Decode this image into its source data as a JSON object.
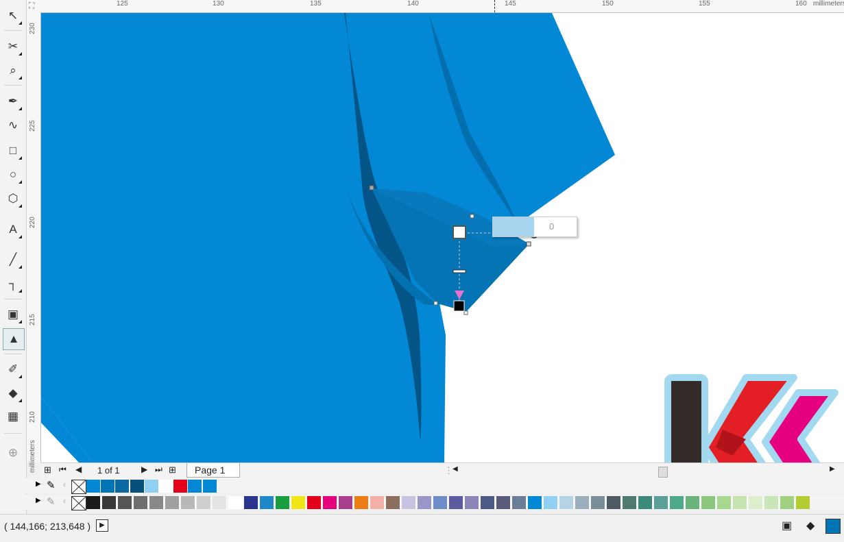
{
  "ruler": {
    "unit_label": "millimeters",
    "h_ticks": [
      "125",
      "130",
      "135",
      "140",
      "145",
      "150",
      "155",
      "160"
    ],
    "v_ticks": [
      "230",
      "225",
      "220",
      "215",
      "210"
    ]
  },
  "toolbox": {
    "tools": [
      {
        "name": "shape-tool-icon",
        "glyph": "↖"
      },
      {
        "name": "crop-tool-icon",
        "glyph": "✂"
      },
      {
        "name": "zoom-tool-icon",
        "glyph": "⌕"
      },
      {
        "name": "pen-tool-icon",
        "glyph": "✒"
      },
      {
        "name": "artistic-media-icon",
        "glyph": "∿"
      },
      {
        "name": "rectangle-tool-icon",
        "glyph": "□"
      },
      {
        "name": "ellipse-tool-icon",
        "glyph": "○"
      },
      {
        "name": "polygon-tool-icon",
        "glyph": "⬡"
      },
      {
        "name": "text-tool-icon",
        "glyph": "A"
      },
      {
        "name": "dimension-tool-icon",
        "glyph": "╱"
      },
      {
        "name": "connector-tool-icon",
        "glyph": "┐"
      },
      {
        "name": "drop-shadow-tool-icon",
        "glyph": "▣"
      },
      {
        "name": "interactive-fill-icon",
        "glyph": "▲"
      },
      {
        "name": "eyedropper-tool-icon",
        "glyph": "✐"
      },
      {
        "name": "smart-fill-icon",
        "glyph": "◆"
      },
      {
        "name": "mesh-fill-icon",
        "glyph": "▦"
      },
      {
        "name": "add-tool-icon",
        "glyph": "⊕"
      }
    ]
  },
  "transparency_tip": {
    "value": "0"
  },
  "pagebar": {
    "page_counter": "1 of 1",
    "tab_label": "Page 1"
  },
  "document_palette": [
    "#0288d4",
    "#0174b5",
    "#0a6aa1",
    "#06507c",
    "#8fd0f3",
    "#ffffff",
    "#e2001a",
    "#0288d4",
    "#0288d4"
  ],
  "default_palette": [
    "#1a1a1a",
    "#3a3a3a",
    "#555555",
    "#6e6e6e",
    "#888888",
    "#a0a0a0",
    "#b8b8b8",
    "#cfcfcf",
    "#e4e4e4",
    "#ffffff",
    "#2a3590",
    "#1e88c8",
    "#1a9d40",
    "#f0e616",
    "#e2001a",
    "#e5007d",
    "#a73f8c",
    "#ef7d16",
    "#f2b0a8",
    "#8c6e5e",
    "#c8c4e0",
    "#9a96c8",
    "#6e8cc8",
    "#5c5aa0",
    "#8c86b8",
    "#4c5a86",
    "#5a5a7a",
    "#6a7e96",
    "#0288d4",
    "#8fd0f3",
    "#b4d4e4",
    "#9aaebc",
    "#7a8e9a",
    "#4e5a62",
    "#4e7a70",
    "#3c8a7a",
    "#5aa096",
    "#4ea88a",
    "#6ab47c",
    "#8cc87c",
    "#a8d890",
    "#c6e4b0",
    "#dceecc",
    "#c8e6b8",
    "#a0d080",
    "#b4cc30"
  ],
  "status": {
    "coords": "( 144,166; 213,648 )"
  },
  "colors": {
    "object_blue": "#0288d4",
    "dark_blue": "#04507e",
    "logo_red": "#e31e24",
    "logo_magenta": "#e4007e",
    "logo_bar": "#332c2a",
    "logo_outline": "#a3d8f1"
  }
}
